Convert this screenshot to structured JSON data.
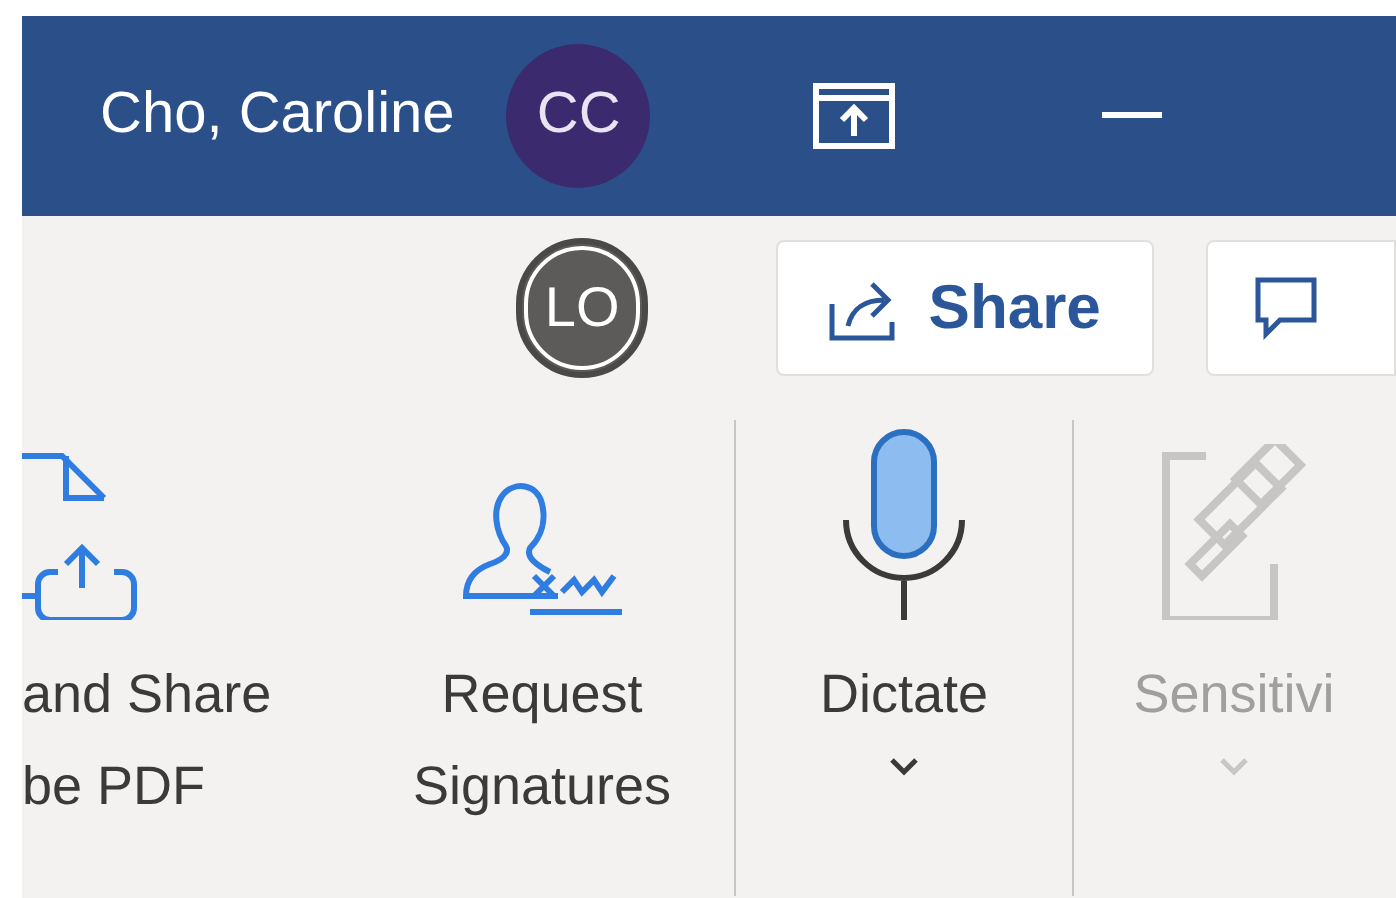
{
  "title_bar": {
    "user_name": "Cho, Caroline",
    "avatar_initials": "CC"
  },
  "ribbon": {
    "collaborator_initials": "LO",
    "share_label": "Share",
    "groups": [
      {
        "commands": [
          {
            "kind": "pdf-share",
            "lines": [
              "and Share",
              "be PDF"
            ],
            "dropdown": false,
            "disabled": false
          },
          {
            "kind": "signature",
            "lines": [
              "Request",
              "Signatures"
            ],
            "dropdown": false,
            "disabled": false
          }
        ]
      },
      {
        "commands": [
          {
            "kind": "dictate",
            "lines": [
              "Dictate"
            ],
            "dropdown": true,
            "disabled": false
          }
        ]
      },
      {
        "commands": [
          {
            "kind": "sensitivity",
            "lines": [
              "Sensitivi"
            ],
            "dropdown": true,
            "disabled": true
          }
        ]
      }
    ]
  }
}
